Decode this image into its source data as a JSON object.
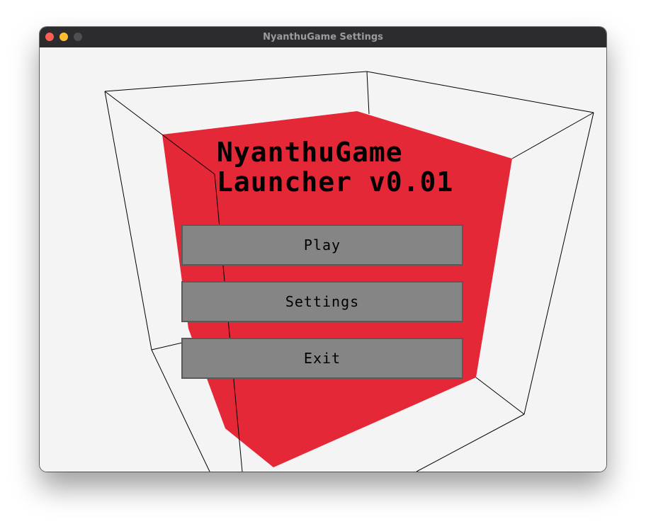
{
  "window": {
    "title": "NyanthuGame Settings"
  },
  "launcher": {
    "title_line1": "NyanthuGame",
    "title_line2": "Launcher v0.01"
  },
  "menu": {
    "play_label": "Play",
    "settings_label": "Settings",
    "exit_label": "Exit"
  },
  "colors": {
    "cube": "#e52837",
    "button_fill": "#858585",
    "button_border": "#5a5a5a",
    "background": "#f4f4f4",
    "titlebar": "#2c2c2e",
    "close": "#fe5f57",
    "minimize": "#febc2e",
    "maximize": "#4f4f52"
  }
}
